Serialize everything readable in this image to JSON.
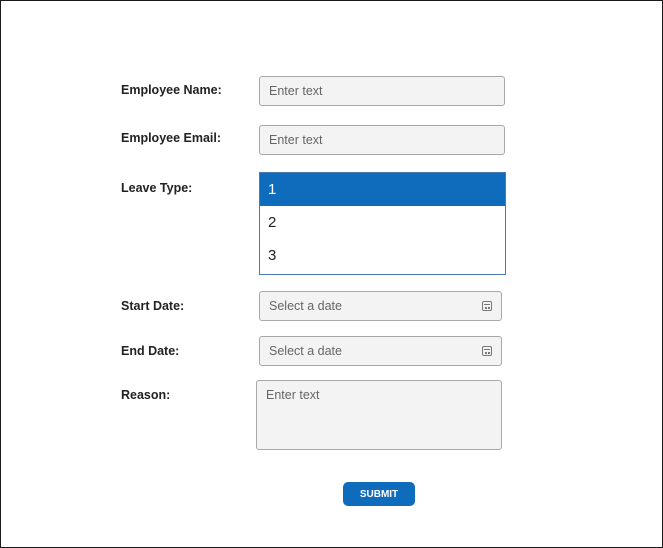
{
  "form": {
    "employee_name": {
      "label": "Employee Name:",
      "placeholder": "Enter text"
    },
    "employee_email": {
      "label": "Employee Email:",
      "placeholder": "Enter text"
    },
    "leave_type": {
      "label": "Leave Type:",
      "options": [
        "1",
        "2",
        "3"
      ],
      "selected": "1"
    },
    "start_date": {
      "label": "Start Date:",
      "placeholder": "Select a date",
      "icon": "calendar-icon"
    },
    "end_date": {
      "label": "End Date:",
      "placeholder": "Select a date",
      "icon": "calendar-icon"
    },
    "reason": {
      "label": "Reason:",
      "placeholder": "Enter text"
    },
    "submit_label": "SUBMIT"
  },
  "colors": {
    "accent": "#0f6cbd",
    "field_bg": "#f3f3f3",
    "field_border": "#a8a8a8"
  }
}
